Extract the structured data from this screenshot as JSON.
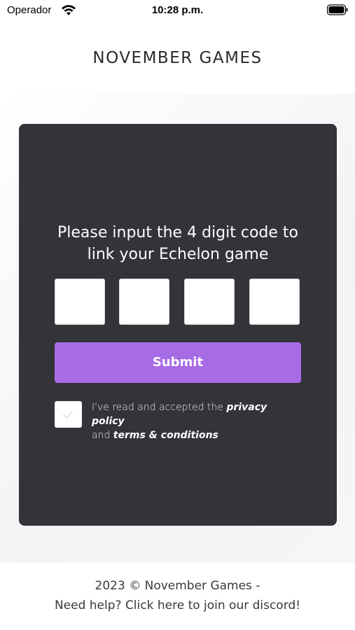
{
  "status_bar": {
    "carrier": "Operador",
    "time": "10:28 p.m.",
    "wifi_icon": "wifi-icon",
    "battery_icon": "battery-icon"
  },
  "header": {
    "brand_title": "NOVEMBER GAMES"
  },
  "card": {
    "heading_line1": "Please input the 4 digit code to",
    "heading_line2": "link your Echelon game",
    "code_inputs": [
      "",
      "",
      "",
      ""
    ],
    "submit_label": "Submit",
    "consent": {
      "checked": false,
      "prefix": "I've read and accepted the",
      "privacy_link": "privacy policy",
      "and": "and",
      "terms_link": "terms & conditions"
    }
  },
  "footer": {
    "copyright": "2023 © November Games  -",
    "help_text": "Need help? Click here to join our discord!"
  },
  "colors": {
    "card_bg": "#323439",
    "accent": "#a86be6",
    "page_bg": "#f1f3f5"
  }
}
